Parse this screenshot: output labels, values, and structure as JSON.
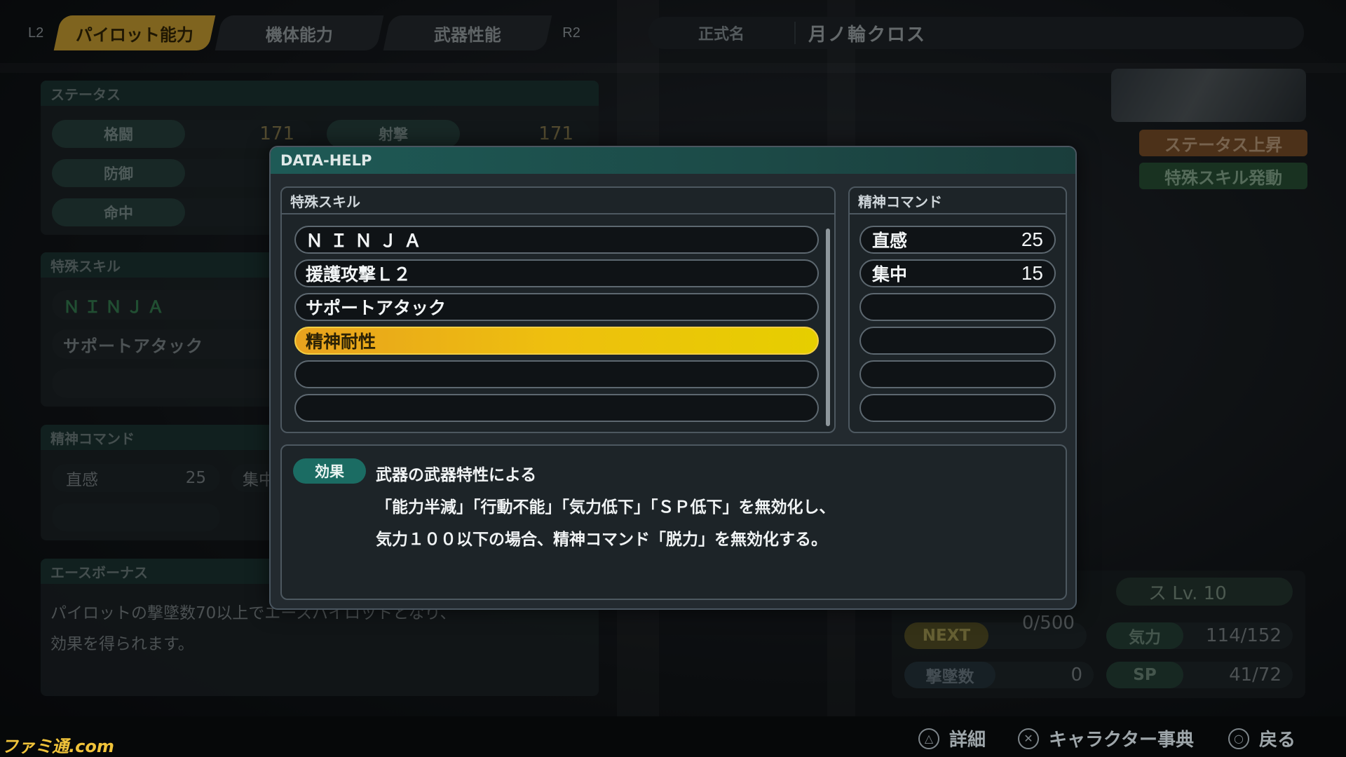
{
  "top_tabs": {
    "left_shoulder": "L2",
    "right_shoulder": "R2",
    "tabs": [
      {
        "label": "パイロット能力",
        "active": true
      },
      {
        "label": "機体能力",
        "active": false
      },
      {
        "label": "武器性能",
        "active": false
      }
    ]
  },
  "name_bar": {
    "label": "正式名",
    "value": "月ノ輪クロス"
  },
  "side_buttons": {
    "status_up": "ステータス上昇",
    "special_skill": "特殊スキル発動"
  },
  "background": {
    "status_panel": {
      "title": "ステータス",
      "stats": [
        {
          "label": "格闘",
          "value": "171"
        },
        {
          "label": "射撃",
          "value": "171"
        },
        {
          "label": "防御",
          "value": ""
        },
        {
          "label": "命中",
          "value": ""
        }
      ]
    },
    "skill_panel": {
      "title": "特殊スキル",
      "items": [
        "ＮＩＮＪＡ",
        "サポートアタック"
      ]
    },
    "spirit_panel": {
      "title": "精神コマンド",
      "items": [
        {
          "name": "直感",
          "cost": "25"
        },
        {
          "name": "集中",
          "cost": ""
        }
      ]
    },
    "ace_panel": {
      "title": "エースボーナス",
      "line1": "パイロットの撃墜数70以上でエースパイロットとなり、",
      "line2": "効果を得られます。"
    },
    "right_stats": {
      "level": "ス Lv. 10",
      "next_label": "NEXT",
      "next_value": "0/500",
      "will_label": "気力",
      "will_value": "114/152",
      "kills_label": "撃墜数",
      "kills_value": "0",
      "sp_label": "SP",
      "sp_value": "41/72"
    }
  },
  "modal": {
    "title": "DATA-HELP",
    "skill_header": "特殊スキル",
    "skills": [
      "ＮＩＮＪＡ",
      "援護攻撃Ｌ２",
      "サポートアタック",
      "精神耐性",
      "",
      ""
    ],
    "selected_skill_index": 3,
    "spirit_header": "精神コマンド",
    "spirits": [
      {
        "name": "直感",
        "cost": "25"
      },
      {
        "name": "集中",
        "cost": "15"
      },
      {
        "name": "",
        "cost": ""
      },
      {
        "name": "",
        "cost": ""
      },
      {
        "name": "",
        "cost": ""
      },
      {
        "name": "",
        "cost": ""
      }
    ],
    "effect": {
      "badge": "効果",
      "lines": [
        "武器の武器特性による",
        "「能力半減」「行動不能」「気力低下」「ＳＰ低下」を無効化し、",
        "気力１００以下の場合、精神コマンド「脱力」を無効化する。"
      ]
    }
  },
  "footer": {
    "items": [
      {
        "icon": "triangle-icon",
        "label": "詳細"
      },
      {
        "icon": "cross-icon",
        "label": "キャラクター事典"
      },
      {
        "icon": "circle-icon",
        "label": "戻る"
      }
    ],
    "watermark": "ファミ通.com"
  },
  "colors": {
    "accent_yellow": "#e7b73a",
    "selection": "#eec00e",
    "teal_header": "#1e5a56",
    "effect_badge": "#1b6c63"
  }
}
